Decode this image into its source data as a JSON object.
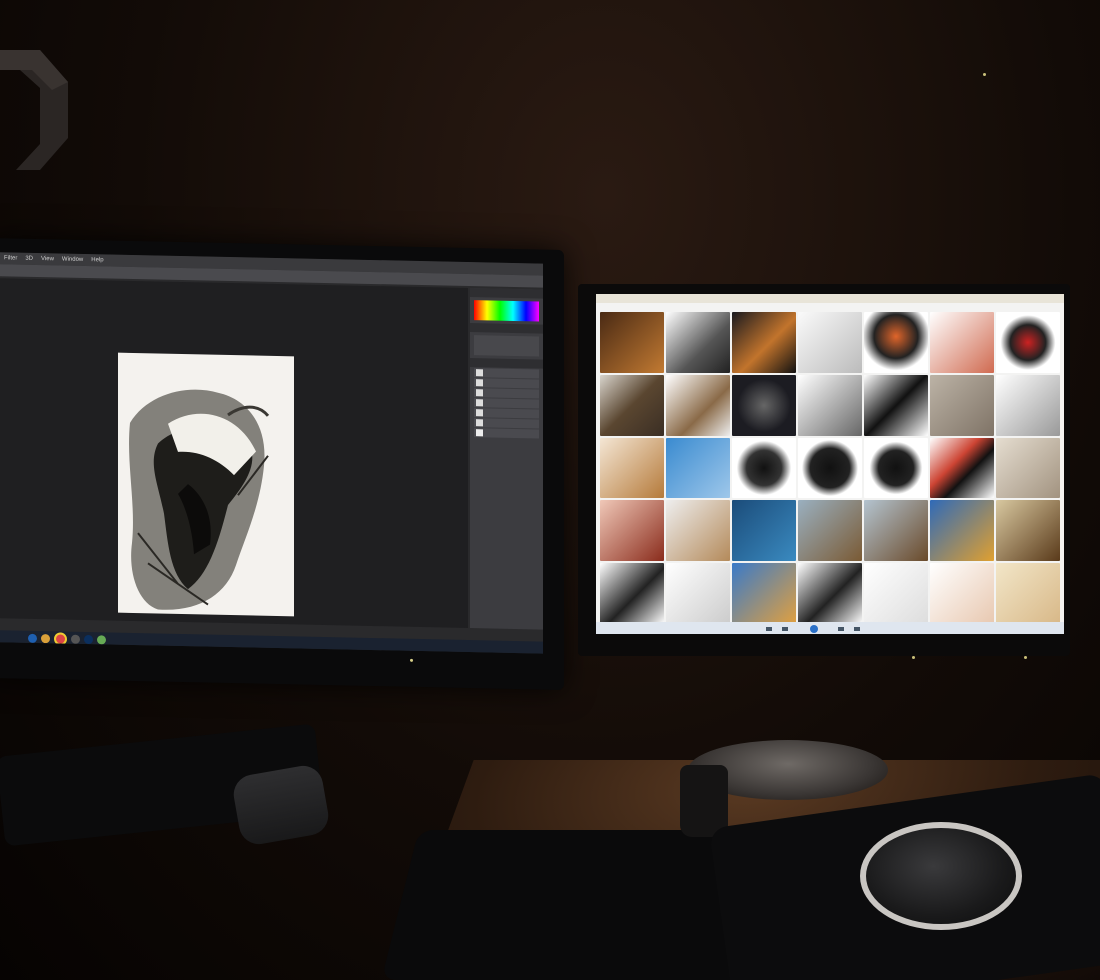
{
  "photoshop": {
    "menu": [
      "Filter",
      "3D",
      "View",
      "Window",
      "Help"
    ]
  }
}
